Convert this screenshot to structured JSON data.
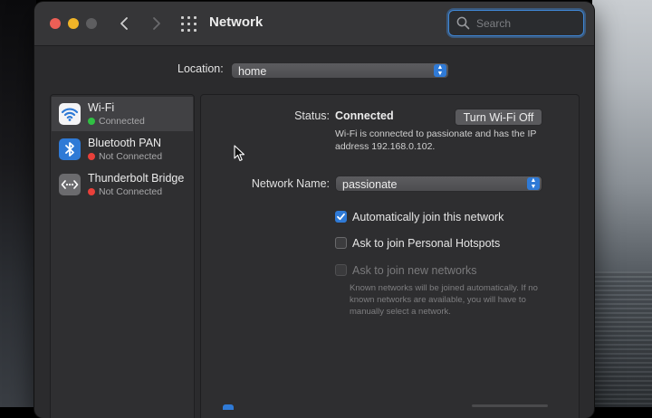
{
  "window": {
    "title": "Network"
  },
  "search": {
    "placeholder": "Search"
  },
  "location": {
    "label": "Location:",
    "value": "home"
  },
  "sidebar": {
    "items": [
      {
        "name": "Wi-Fi",
        "status": "Connected",
        "status_color": "#30c043",
        "selected": true,
        "icon": "wifi-icon"
      },
      {
        "name": "Bluetooth PAN",
        "status": "Not Connected",
        "status_color": "#e9403a",
        "selected": false,
        "icon": "bluetooth-icon"
      },
      {
        "name": "Thunderbolt Bridge",
        "status": "Not Connected",
        "status_color": "#e9403a",
        "selected": false,
        "icon": "thunderbolt-bridge-icon"
      }
    ]
  },
  "detail": {
    "status_label": "Status:",
    "status_value": "Connected",
    "toggle_button": "Turn Wi-Fi Off",
    "status_description": "Wi-Fi is connected to passionate and has the IP address 192.168.0.102.",
    "network_name_label": "Network Name:",
    "network_name_value": "passionate",
    "options": [
      {
        "label": "Automatically join this network",
        "checked": true,
        "enabled": true
      },
      {
        "label": "Ask to join Personal Hotspots",
        "checked": false,
        "enabled": true
      },
      {
        "label": "Ask to join new networks",
        "checked": false,
        "enabled": false
      }
    ],
    "options_note": "Known networks will be joined automatically. If no known networks are available, you will have to manually select a network."
  },
  "colors": {
    "accent": "#2f7ad6",
    "window_bg": "#2b2b2d",
    "titlebar": "#363638"
  }
}
